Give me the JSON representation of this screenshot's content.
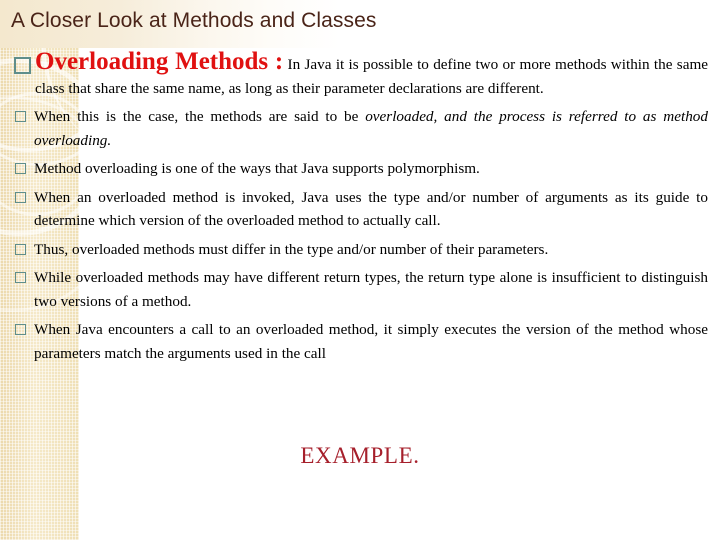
{
  "slide": {
    "title": "A Closer Look at Methods and Classes",
    "title_color": "#4a2418",
    "accent_red": "#e01111",
    "example_color": "#a61f2b",
    "band_color": "#f0dfb8",
    "marker_color": "#5f8e8b",
    "background": "#ffffff"
  },
  "bullets": [
    {
      "marker": "hollow-square",
      "size": "large",
      "heading": "Overloading Methods :",
      "text": " In Java it is possible to define two or more methods within the same class that share the same name, as long as their parameter declarations are different."
    },
    {
      "marker": "hollow-square",
      "size": "small",
      "text_plain": "When this is the case, the methods are said to be ",
      "text_italic": "overloaded, and the process is referred to as method overloading."
    },
    {
      "marker": "hollow-square",
      "size": "small",
      "text": "Method overloading is one of the ways that Java supports polymorphism."
    },
    {
      "marker": "hollow-square",
      "size": "small",
      "text": "When an overloaded method is invoked, Java uses the type and/or number of arguments as its guide to determine which version of the overloaded method to actually call."
    },
    {
      "marker": "hollow-square",
      "size": "small",
      "text": "Thus, overloaded methods must differ in the type and/or number of their parameters."
    },
    {
      "marker": "hollow-square",
      "size": "small",
      "text": "While overloaded methods may have different return types, the return type alone is insufficient to distinguish two versions of a method."
    },
    {
      "marker": "hollow-square",
      "size": "small",
      "text": "When Java encounters a call to an overloaded method, it simply executes the version of the method whose parameters match the arguments used in the call"
    }
  ],
  "footer": {
    "example_label": "EXAMPLE."
  }
}
